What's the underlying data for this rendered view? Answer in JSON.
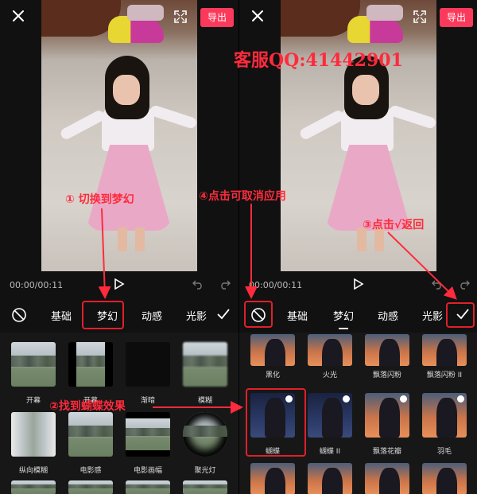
{
  "colors": {
    "accent": "#fb3a5b",
    "annotation": "#ff2b3d"
  },
  "left_panel": {
    "export_label": "导出",
    "time": "00:00/00:11",
    "tabs": [
      "基础",
      "梦幻",
      "动感",
      "光影"
    ],
    "effects": [
      {
        "label": "开幕"
      },
      {
        "label": "开幕"
      },
      {
        "label": "渐暗"
      },
      {
        "label": "模糊"
      },
      {
        "label": "纵向模糊"
      },
      {
        "label": "电影感"
      },
      {
        "label": "电影画幅"
      },
      {
        "label": "聚光灯"
      }
    ]
  },
  "right_panel": {
    "export_label": "导出",
    "time": "00:00/00:11",
    "tabs": [
      "基础",
      "梦幻",
      "动感",
      "光影"
    ],
    "effects": [
      {
        "label": "黑化"
      },
      {
        "label": "火光"
      },
      {
        "label": "飘落闪粉"
      },
      {
        "label": "飘落闪粉 II"
      },
      {
        "label": "蝴蝶"
      },
      {
        "label": "蝴蝶 II"
      },
      {
        "label": "飘落花瓣"
      },
      {
        "label": "羽毛"
      }
    ]
  },
  "annotations": {
    "contact": "客服QQ:41442901",
    "step1": "① 切换到梦幻",
    "step2": "②找到蝴蝶效果",
    "step3": "③点击√返回",
    "step4": "④点击可取消应用"
  }
}
